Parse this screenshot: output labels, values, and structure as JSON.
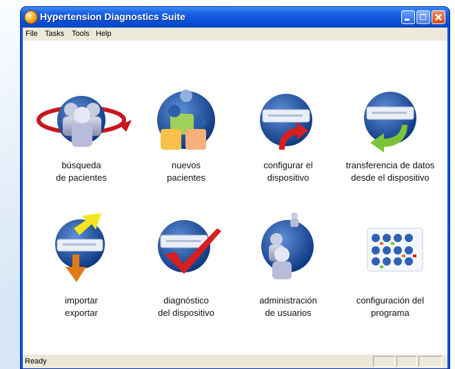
{
  "window": {
    "title": "Hypertension Diagnostics Suite"
  },
  "menu": [
    "File",
    "Tasks",
    "Tools",
    "Help"
  ],
  "items": [
    {
      "line1": "búsqueda",
      "line2": "de pacientes",
      "icon": "patient-search-icon"
    },
    {
      "line1": "nuevos",
      "line2": "pacientes",
      "icon": "new-patients-icon"
    },
    {
      "line1": "configurar el",
      "line2": "dispositivo",
      "icon": "configure-device-icon"
    },
    {
      "line1": "transferencia de datos",
      "line2": "desde el dispositivo",
      "icon": "transfer-data-icon"
    },
    {
      "line1": "importar",
      "line2": "exportar",
      "icon": "import-export-icon"
    },
    {
      "line1": "diagnóstico",
      "line2": "del dispositivo",
      "icon": "device-diagnostic-icon"
    },
    {
      "line1": "administración",
      "line2": "de usuarios",
      "icon": "user-admin-icon"
    },
    {
      "line1": "configuración del",
      "line2": "programa",
      "icon": "program-settings-icon"
    }
  ],
  "status": "Ready",
  "colors": {
    "titlebar": "#0a52d8",
    "menubar": "#ece9d8",
    "globe": "#1e4f9c",
    "arrow_red": "#d81e1e",
    "arrow_green": "#7cc23a",
    "arrow_yellow": "#f4e61c",
    "arrow_orange": "#e07a16"
  }
}
